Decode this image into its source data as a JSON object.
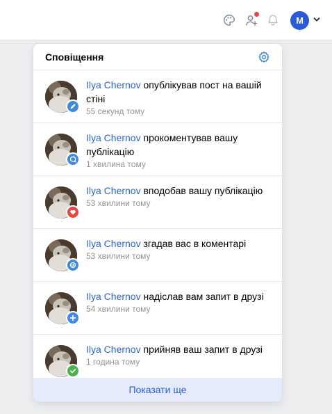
{
  "topbar": {
    "icons": [
      "palette-icon",
      "friends-icon",
      "bell-icon"
    ],
    "avatar_letter": "M",
    "has_new_friend_request": true
  },
  "panel": {
    "title": "Сповіщення",
    "settings_icon": "gear-icon",
    "show_more": "Показати ще"
  },
  "notifications": [
    {
      "user": "Ilya Chernov",
      "action": " опублікував пост на вашій стіні",
      "time": "55 секунд тому",
      "badge_icon": "pencil-icon",
      "badge_color": "#3f8ae0"
    },
    {
      "user": "Ilya Chernov",
      "action": " прокоментував вашу публікацію",
      "time": "1 хвилина тому",
      "badge_icon": "comment-icon",
      "badge_color": "#3f8ae0"
    },
    {
      "user": "Ilya Chernov",
      "action": " вподобав вашу публікацію",
      "time": "53 хвилини тому",
      "badge_icon": "heart-icon",
      "badge_color": "#e64646"
    },
    {
      "user": "Ilya Chernov",
      "action": " згадав вас в коментарі",
      "time": "53 хвилини тому",
      "badge_icon": "mention-icon",
      "badge_color": "#3f8ae0"
    },
    {
      "user": "Ilya Chernov",
      "action": " надіслав вам запит в друзі",
      "time": "54 хвилини тому",
      "badge_icon": "plus-icon",
      "badge_color": "#3f8ae0"
    },
    {
      "user": "Ilya Chernov",
      "action": " прийняв ваш запит в друзі",
      "time": "1 година тому",
      "badge_icon": "check-icon",
      "badge_color": "#4bb34b"
    }
  ]
}
